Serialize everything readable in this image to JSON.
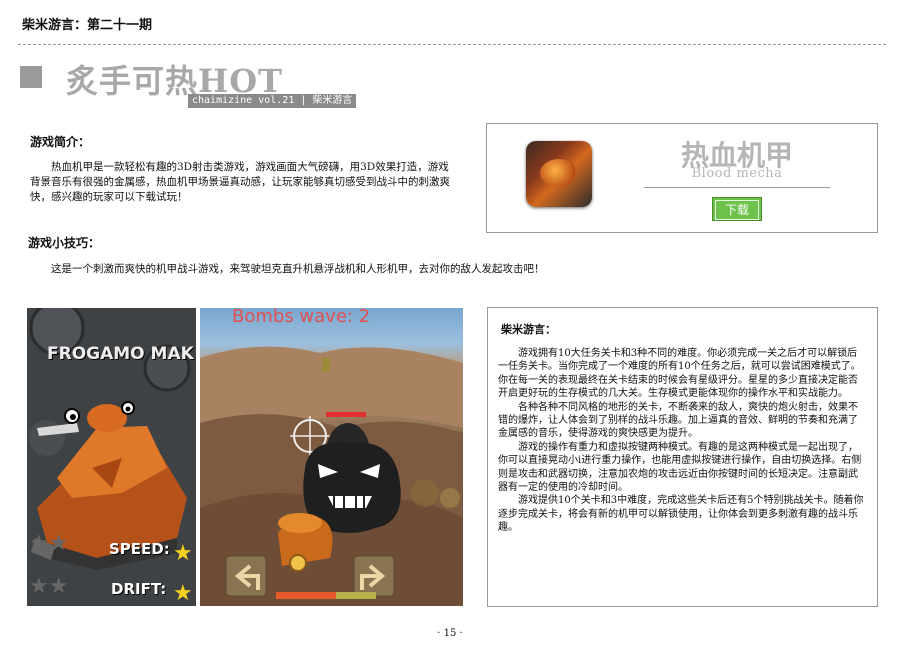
{
  "header": {
    "issue_label": "柴米游言：第二十一期"
  },
  "section": {
    "title": "炙手可热HOT",
    "tag": "chaimizine vol.21 | 柴米游言"
  },
  "intro": {
    "heading": "游戏简介：",
    "text": "热血机甲是一款轻松有趣的3D射击类游戏，游戏画面大气磅礴，用3D效果打造，游戏背景音乐有很强的金属感，热血机甲场景逼真动感，让玩家能够真切感受到战斗中的刺激爽快，感兴趣的玩家可以下载试玩！"
  },
  "tips": {
    "heading": "游戏小技巧：",
    "text": "这是一个刺激而爽快的机甲战斗游戏，来驾驶坦克直升机悬浮战机和人形机甲，去对你的敌人发起攻击吧！"
  },
  "game_card": {
    "name_cn": "热血机甲",
    "name_en": "Blood  mecha",
    "download_label": "下载",
    "icon": "game-app-icon"
  },
  "screenshot_left": {
    "title": "FROGAMO MAK",
    "speed_label": "SPEED:",
    "drift_label": "DRIFT:"
  },
  "screenshot_right": {
    "wave_text": "Bombs wave: 2"
  },
  "review": {
    "heading": "柴米游言：",
    "p1": "游戏拥有10大任务关卡和3种不同的难度。你必须完成一关之后才可以解锁后一任务关卡。当你完成了一个难度的所有10个任务之后，就可以尝试困难模式了。你在每一关的表现最终在关卡结束的时候会有星级评分。星星的多少直接决定能否开启更好玩的生存模式的几大关。生存模式更能体现你的操作水平和实战能力。",
    "p2": "各种各种不同风格的地形的关卡，不断袭来的敌人，爽快的炮火射击，效果不错的爆炸，让人体会到了别样的战斗乐趣。加上逼真的音效、鲜明的节奏和充满了金属感的音乐，使得游戏的爽快感更为提升。",
    "p3": "游戏的操作有重力和虚拟按键两种模式。有趣的是这两种模式是一起出现了，你可以直接晃动小i进行重力操作，也能用虚拟按键进行操作，自由切换选择。右侧则是攻击和武器切换，注意加农炮的攻击远近由你按键时间的长短决定。注意副武器有一定的使用的冷却时间。",
    "p4": "游戏提供10个关卡和3中难度，完成这些关卡后还有5个特别挑战关卡。随着你逐步完成关卡，将会有新的机甲可以解锁使用，让你体会到更多刺激有趣的战斗乐趣。"
  },
  "footer": {
    "page": "· 15 ·"
  }
}
